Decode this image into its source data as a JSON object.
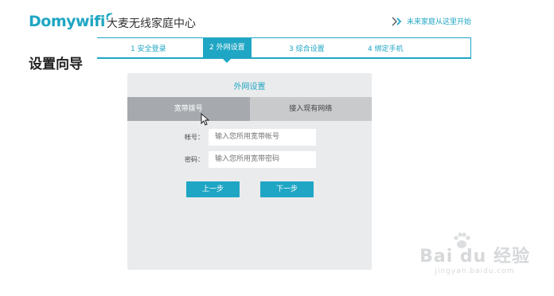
{
  "header": {
    "logo_text": "Domywifi",
    "brand_name": "大麦无线家庭中心",
    "start_link": "未来家庭从这里开始"
  },
  "steps": [
    {
      "label": "1 安全登录",
      "active": false
    },
    {
      "label": "2 外网设置",
      "active": true
    },
    {
      "label": "3 综合设置",
      "active": false
    },
    {
      "label": "4 绑定手机",
      "active": false
    }
  ],
  "page_title": "设置向导",
  "card": {
    "title": "外网设置",
    "tabs": [
      {
        "label": "宽带拨号",
        "active": true
      },
      {
        "label": "接入现有网络",
        "active": false
      }
    ],
    "account": {
      "label": "帐号：",
      "placeholder": "输入您所用宽带帐号"
    },
    "password": {
      "label": "密码：",
      "placeholder": "输入您所用宽带密码"
    },
    "prev_button": "上一步",
    "next_button": "下一步"
  },
  "watermark": {
    "main": "Bai du 经验",
    "sub": "jingyan.baidu.com"
  },
  "colors": {
    "accent": "#1fa6c4",
    "card_bg": "#eaebec",
    "tab_active": "#a6aaae",
    "tab_inactive": "#c8cacc"
  }
}
